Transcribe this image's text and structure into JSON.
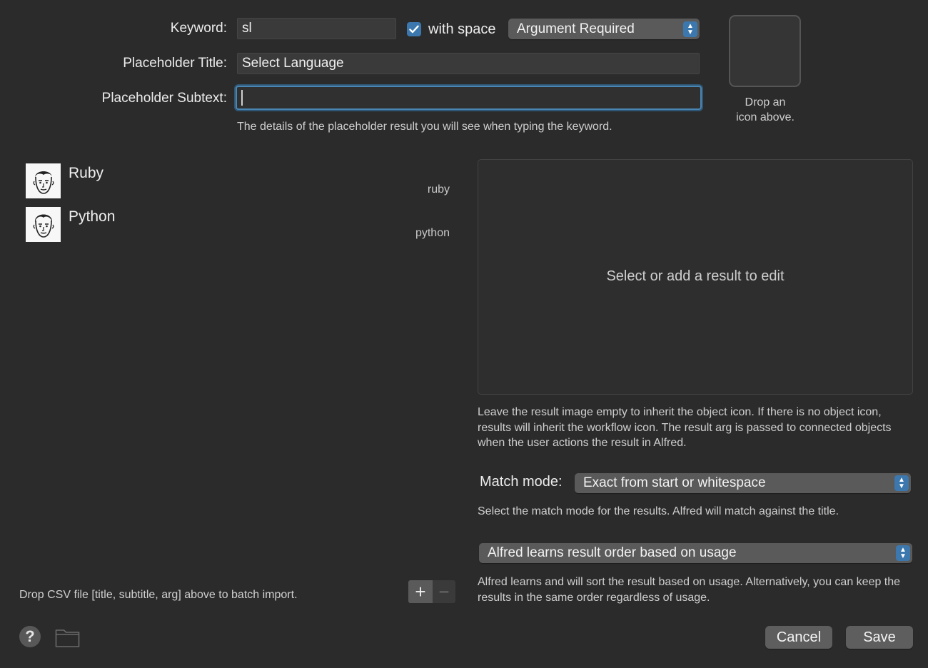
{
  "form": {
    "keyword_label": "Keyword:",
    "keyword_value": "sl",
    "with_space_label": "with space",
    "with_space_checked": true,
    "argument_mode": "Argument Required",
    "placeholder_title_label": "Placeholder Title:",
    "placeholder_title_value": "Select Language",
    "placeholder_subtext_label": "Placeholder Subtext:",
    "placeholder_subtext_value": "",
    "placeholder_hint": "The details of the placeholder result you will see when typing the keyword.",
    "icon_hint_line1": "Drop an",
    "icon_hint_line2": "icon above."
  },
  "results": [
    {
      "title": "Ruby",
      "arg": "ruby"
    },
    {
      "title": "Python",
      "arg": "python"
    }
  ],
  "editor": {
    "empty_message": "Select or add a result to edit",
    "image_hint": "Leave the result image empty to inherit the object icon. If there is no object icon, results will inherit the workflow icon. The result arg is passed to connected objects when the user actions the result in Alfred.",
    "match_mode_label": "Match mode:",
    "match_mode_value": "Exact from start or whitespace",
    "match_mode_hint": "Select the match mode for the results. Alfred will match against the title.",
    "order_value": "Alfred learns result order based on usage",
    "order_hint": "Alfred learns and will sort the result based on usage. Alternatively, you can keep the results in the same order regardless of usage."
  },
  "footer": {
    "csv_hint": "Drop CSV file [title, subtitle, arg] above to batch import.",
    "add_symbol": "+",
    "remove_symbol": "−",
    "help_symbol": "?",
    "cancel_label": "Cancel",
    "save_label": "Save"
  },
  "colors": {
    "background": "#2b2b2b",
    "accent": "#3c78ad",
    "focus_ring": "#4a86b4"
  }
}
